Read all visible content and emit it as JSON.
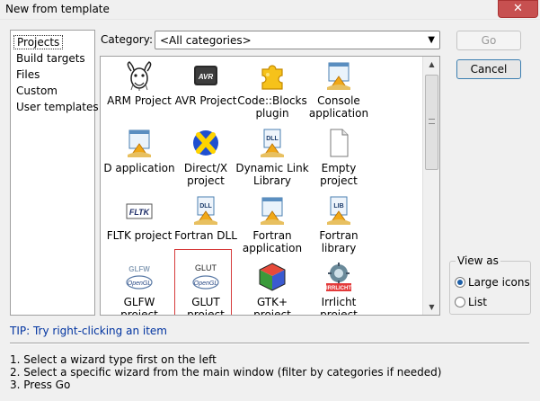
{
  "window": {
    "title": "New from template",
    "close_glyph": "✕"
  },
  "sidebar": {
    "items": [
      {
        "label": "Projects",
        "selected": true
      },
      {
        "label": "Build targets"
      },
      {
        "label": "Files"
      },
      {
        "label": "Custom"
      },
      {
        "label": "User templates"
      }
    ]
  },
  "category": {
    "label": "Category:",
    "selected": "<All categories>"
  },
  "templates": [
    {
      "line1": "ARM Project",
      "line2": "",
      "icon": "gnu-head-icon"
    },
    {
      "line1": "AVR Project",
      "line2": "",
      "icon": "avr-chip-icon"
    },
    {
      "line1": "Code::Blocks",
      "line2": "plugin",
      "icon": "puzzle-piece-icon"
    },
    {
      "line1": "Console",
      "line2": "application",
      "icon": "console-app-icon"
    },
    {
      "line1": "D application",
      "line2": "",
      "icon": "window-app-icon"
    },
    {
      "line1": "Direct/X",
      "line2": "project",
      "icon": "directx-icon"
    },
    {
      "line1": "Dynamic Link",
      "line2": "Library",
      "icon": "dll-icon"
    },
    {
      "line1": "Empty",
      "line2": "project",
      "icon": "empty-file-icon"
    },
    {
      "line1": "FLTK project",
      "line2": "",
      "icon": "fltk-icon"
    },
    {
      "line1": "Fortran DLL",
      "line2": "",
      "icon": "dll-icon"
    },
    {
      "line1": "Fortran",
      "line2": "application",
      "icon": "window-app-icon"
    },
    {
      "line1": "Fortran",
      "line2": "library",
      "icon": "lib-icon"
    },
    {
      "line1": "GLFW",
      "line2": "project",
      "icon": "glfw-opengl-icon"
    },
    {
      "line1": "GLUT",
      "line2": "project",
      "icon": "glut-opengl-icon",
      "selected": true
    },
    {
      "line1": "GTK+",
      "line2": "project",
      "icon": "gtk-cube-icon"
    },
    {
      "line1": "Irrlicht",
      "line2": "project",
      "icon": "irrlicht-icon"
    }
  ],
  "icon_text": {
    "avr": "AVR",
    "dll": "DLL",
    "lib": "LIB",
    "fltk": "FLTK",
    "glfw": "GLFW",
    "glut": "GLUT",
    "opengl": "OpenGL",
    "irr": "IRRLICHT"
  },
  "buttons": {
    "go": "Go",
    "cancel": "Cancel"
  },
  "view_as": {
    "title": "View as",
    "options": [
      {
        "label": "Large icons",
        "checked": true
      },
      {
        "label": "List",
        "checked": false
      }
    ]
  },
  "tip": "TIP: Try right-clicking an item",
  "instructions": [
    "1. Select a wizard type first on the left",
    "2. Select a specific wizard from the main window (filter by categories if needed)",
    "3. Press Go"
  ],
  "colors": {
    "accent": "#1d5fa8",
    "tip": "#0033a0",
    "selection_border": "#d63a3a",
    "close_button": "#c75050"
  }
}
